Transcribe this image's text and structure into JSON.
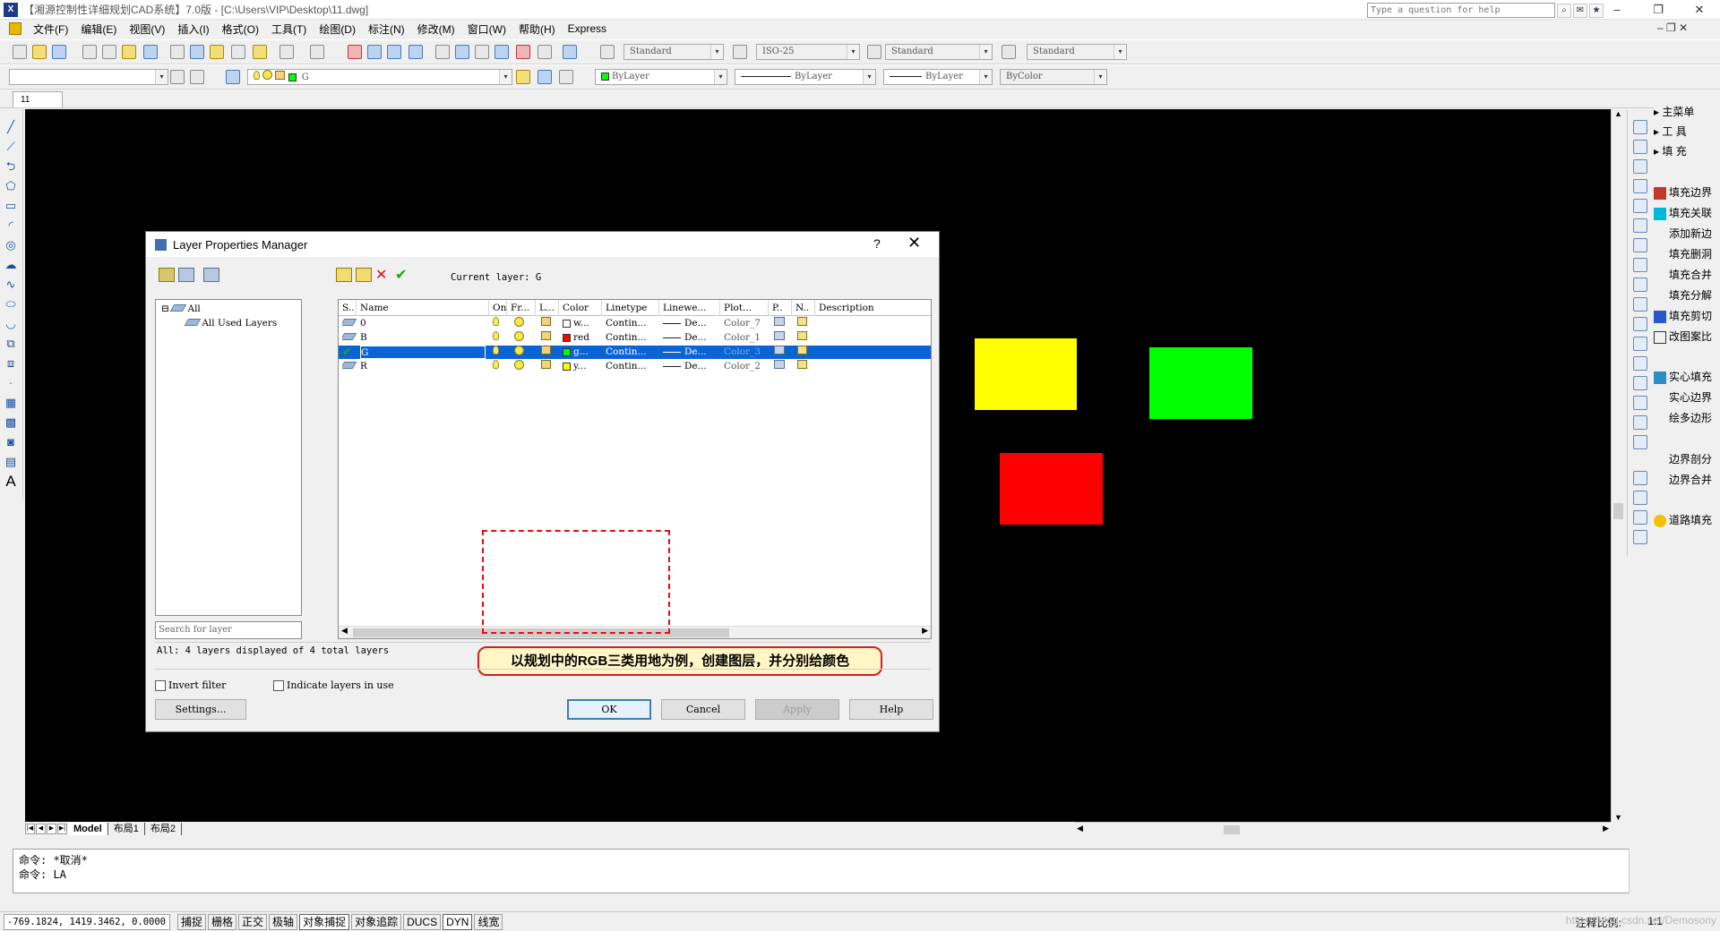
{
  "window": {
    "title": "【湘源控制性详细规划CAD系统】7.0版 - [C:\\Users\\VIP\\Desktop\\11.dwg]",
    "help_placeholder": "Type a question for help"
  },
  "menu": [
    "文件(F)",
    "编辑(E)",
    "视图(V)",
    "插入(I)",
    "格式(O)",
    "工具(T)",
    "绘图(D)",
    "标注(N)",
    "修改(M)",
    "窗口(W)",
    "帮助(H)",
    "Express"
  ],
  "toolbar": {
    "text_style": "Standard",
    "dim_style": "ISO-25",
    "table_style": "Standard",
    "mleader_style": "Standard",
    "layer_combo": "G",
    "color": "ByLayer",
    "linetype": "ByLayer",
    "lineweight": "ByLayer",
    "plotstyle": "ByColor"
  },
  "doc_tab": "11",
  "right_panel": {
    "headers": [
      "主菜单",
      "工  具",
      "填  充"
    ],
    "items": [
      "填充边界",
      "填充关联",
      "添加新边",
      "填充删洞",
      "填充合并",
      "填充分解",
      "填充剪切",
      "改图案比",
      "实心填充",
      "实心边界",
      "绘多边形",
      "边界剖分",
      "边界合并",
      "道路填充"
    ]
  },
  "layout_tabs": [
    "Model",
    "布局1",
    "布局2"
  ],
  "command_lines": [
    "命令: *取消*",
    "命令: LA"
  ],
  "status": {
    "coords": "-769.1824,  1419.3462,  0.0000",
    "buttons": [
      {
        "label": "捕捉",
        "on": false
      },
      {
        "label": "栅格",
        "on": false
      },
      {
        "label": "正交",
        "on": false
      },
      {
        "label": "极轴",
        "on": false
      },
      {
        "label": "对象捕捉",
        "on": true
      },
      {
        "label": "对象追踪",
        "on": false
      },
      {
        "label": "DUCS",
        "on": false
      },
      {
        "label": "DYN",
        "on": true
      },
      {
        "label": "线宽",
        "on": false
      }
    ],
    "scale_label": "注释比例:",
    "scale_value": "1:1",
    "watermark": "https://blog.csdn.net/Demosony"
  },
  "dialog": {
    "title": "Layer Properties Manager",
    "help_glyph": "?",
    "close_glyph": "✕",
    "current_layer": "Current layer: G",
    "tree": {
      "root": "All",
      "child": "All Used Layers"
    },
    "search_placeholder": "Search for layer",
    "columns": [
      "S..",
      "Name",
      "On",
      "Fr...",
      "L...",
      "Color",
      "Linetype",
      "Linewe...",
      "Plot...",
      "P..",
      "N..",
      "Description"
    ],
    "layers": [
      {
        "name": "0",
        "color_name": "w...",
        "color_hex": "#ffffff",
        "linetype": "Contin...",
        "lineweight": "De...",
        "plot": "Color_7",
        "selected": false,
        "current": false
      },
      {
        "name": "B",
        "color_name": "red",
        "color_hex": "#ff0000",
        "linetype": "Contin...",
        "lineweight": "De...",
        "plot": "Color_1",
        "selected": false,
        "current": false
      },
      {
        "name": "G",
        "color_name": "g...",
        "color_hex": "#00ff00",
        "linetype": "Contin...",
        "lineweight": "De...",
        "plot": "Color_3",
        "selected": true,
        "current": true
      },
      {
        "name": "R",
        "color_name": "y...",
        "color_hex": "#ffff00",
        "linetype": "Contin...",
        "lineweight": "De...",
        "plot": "Color_2",
        "selected": false,
        "current": false
      }
    ],
    "status_line": "All: 4 layers displayed of 4 total layers",
    "invert_filter": "Invert filter",
    "indicate_layers": "Indicate layers in use",
    "settings_button": "Settings...",
    "ok_button": "OK",
    "cancel_button": "Cancel",
    "apply_button": "Apply",
    "help_button": "Help"
  },
  "annotation": "以规划中的RGB三类用地为例，创建图层，并分别给颜色",
  "colors": {
    "yellow": "#ffff00",
    "green": "#00ff00",
    "red": "#ff0000",
    "canvas": "#000000",
    "selection": "#0a64d6"
  }
}
